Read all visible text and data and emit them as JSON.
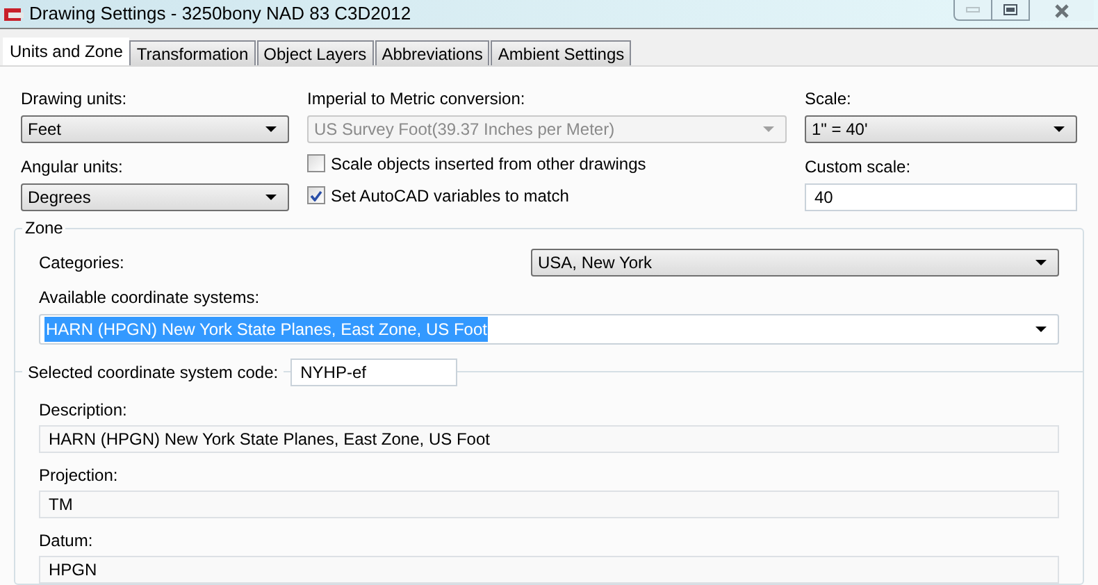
{
  "window": {
    "title": "Drawing Settings - 3250bony NAD 83 C3D2012"
  },
  "tabs": [
    {
      "label": "Units and Zone",
      "selected": true
    },
    {
      "label": "Transformation",
      "selected": false
    },
    {
      "label": "Object Layers",
      "selected": false
    },
    {
      "label": "Abbreviations",
      "selected": false
    },
    {
      "label": "Ambient Settings",
      "selected": false
    }
  ],
  "drawing_units": {
    "label": "Drawing units:",
    "value": "Feet"
  },
  "angular_units": {
    "label": "Angular units:",
    "value": "Degrees"
  },
  "conversion": {
    "label": "Imperial to Metric conversion:",
    "value": "US Survey Foot(39.37 Inches per Meter)",
    "disabled": true
  },
  "checkboxes": [
    {
      "label": "Scale objects inserted from other drawings",
      "checked": false
    },
    {
      "label": "Set AutoCAD variables to match",
      "checked": true
    }
  ],
  "scale": {
    "label": "Scale:",
    "value": "1\" = 40'"
  },
  "custom_scale": {
    "label": "Custom scale:",
    "value": "40"
  },
  "zone": {
    "title": "Zone",
    "categories": {
      "label": "Categories:",
      "value": "USA, New York"
    },
    "available": {
      "label": "Available coordinate systems:",
      "value": "HARN (HPGN) New York State Planes, East Zone, US Foot",
      "selected": true
    },
    "code": {
      "label": "Selected coordinate system code:",
      "value": "NYHP-ef"
    },
    "description": {
      "label": "Description:",
      "value": "HARN (HPGN) New York State Planes, East Zone, US Foot"
    },
    "projection": {
      "label": "Projection:",
      "value": "TM"
    },
    "datum": {
      "label": "Datum:",
      "value": "HPGN"
    }
  }
}
